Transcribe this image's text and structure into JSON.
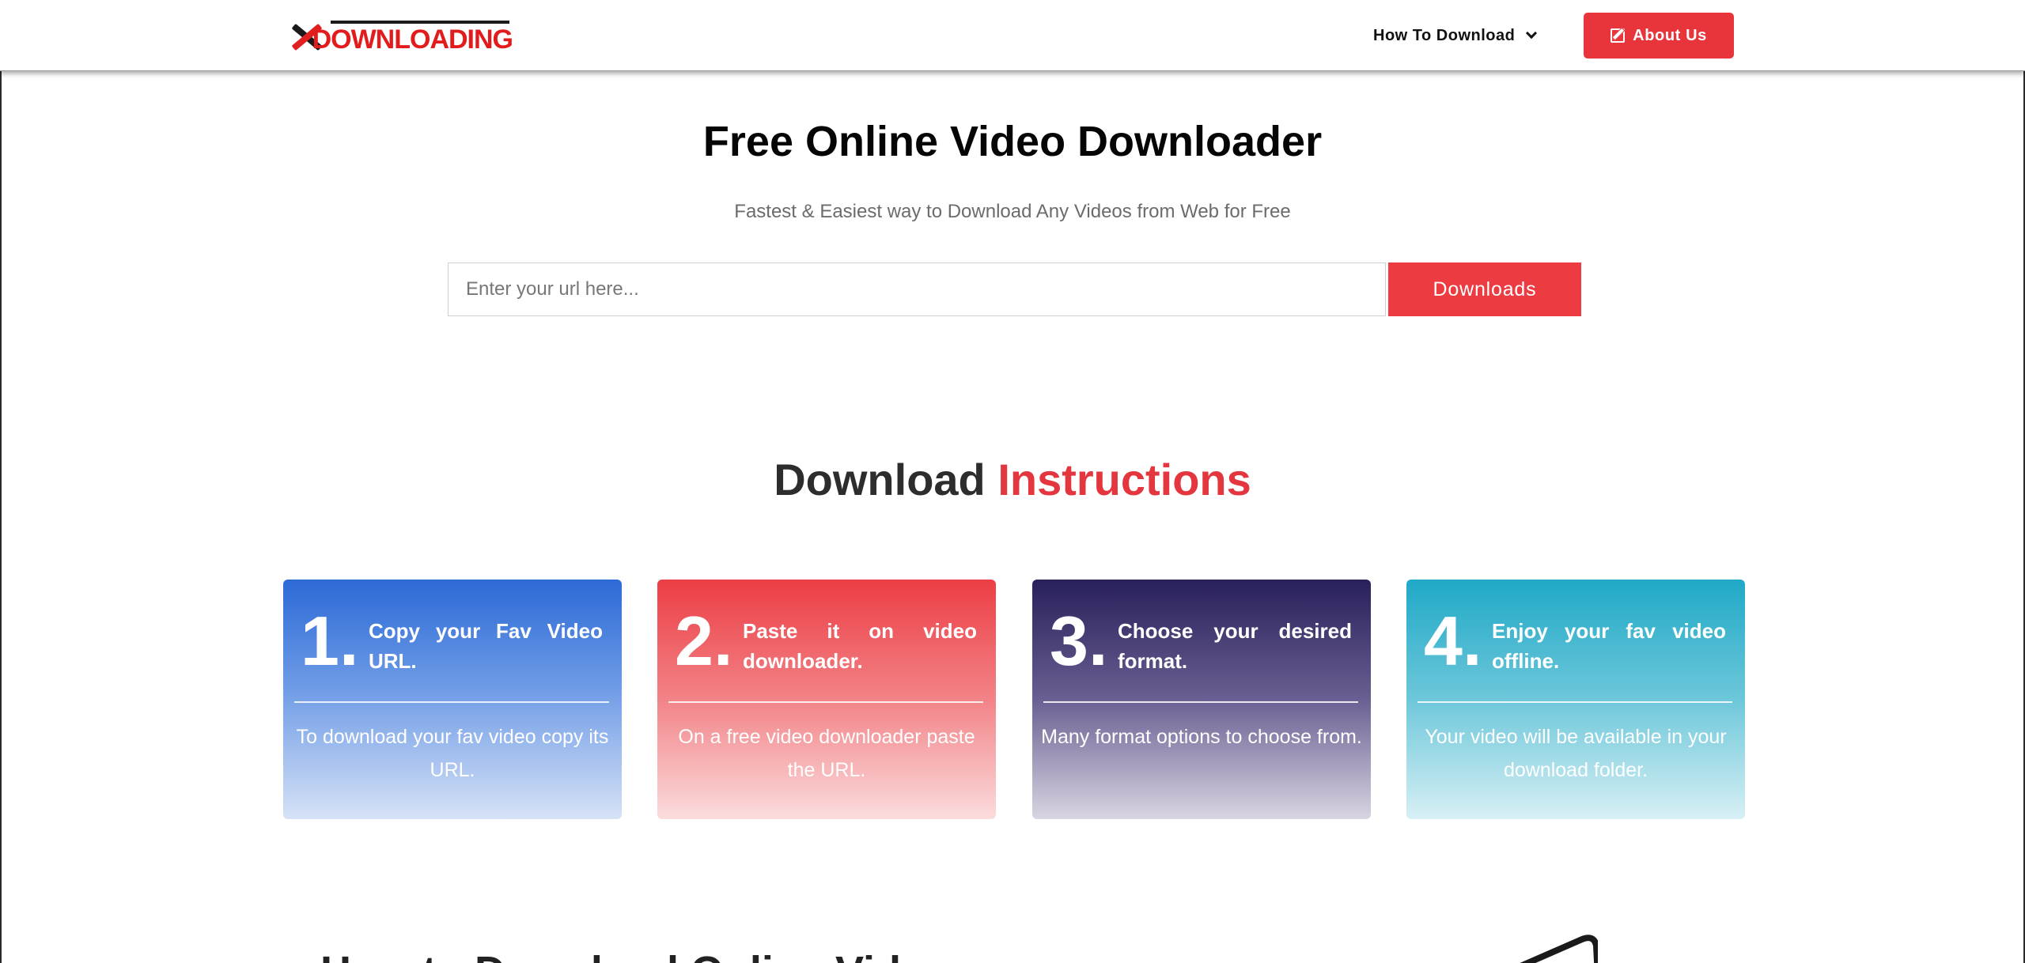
{
  "header": {
    "logo_text": "DOWNLOADING",
    "nav": {
      "how_to_label": "How To Download",
      "about_label": "About Us"
    }
  },
  "hero": {
    "title": "Free Online Video Downloader",
    "subtitle": "Fastest & Easiest way to Download Any Videos from Web for Free",
    "url_input": {
      "placeholder": "Enter your url here...",
      "value": ""
    },
    "button_label": "Downloads"
  },
  "instructions": {
    "title_prefix": "Download ",
    "title_accent": "Instructions",
    "cards": [
      {
        "number": "1.",
        "heading": "Copy your Fav Video URL.",
        "description": "To download your fav video copy its URL.",
        "color": "#2c6ad6"
      },
      {
        "number": "2.",
        "heading": "Paste it on video downloader.",
        "description": "On a free video downloader paste the URL.",
        "color": "#ec3e44"
      },
      {
        "number": "3.",
        "heading": "Choose your desired format.",
        "description": "Many format options to choose from.",
        "color": "#28205a"
      },
      {
        "number": "4.",
        "heading": "Enjoy your fav video offline.",
        "description": "Your video will be available in your download folder.",
        "color": "#20a9c7"
      }
    ]
  },
  "how_to": {
    "title": "How to Download Online Vid"
  },
  "colors": {
    "accent": "#e8353c",
    "title_dark": "#050505",
    "subtitle_gray": "#6b6b6b"
  },
  "icons": [
    "x-logo-icon",
    "chevron-down-icon",
    "edit-icon"
  ]
}
